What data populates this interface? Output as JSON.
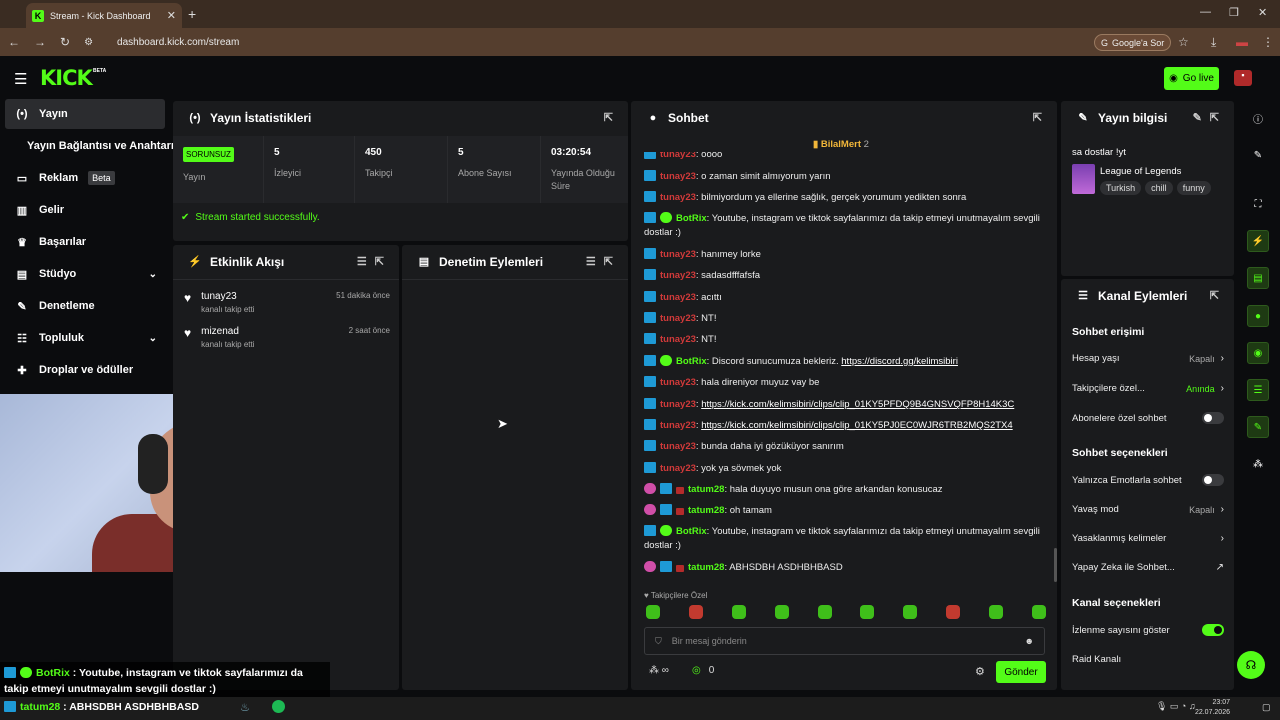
{
  "browser": {
    "tab_title": "Stream - Kick Dashboard",
    "url": "dashboard.kick.com/stream",
    "google_ask": "Google'a Sor"
  },
  "header": {
    "logo": "KICK",
    "beta": "BETA",
    "go_live": "Go live"
  },
  "sidebar": {
    "items": [
      {
        "label": "Yayın",
        "icon": "broadcast-icon"
      },
      {
        "label": "Yayın Bağlantısı ve Anahtarı"
      },
      {
        "label": "Reklam",
        "badge": "Beta",
        "icon": "ad-icon"
      },
      {
        "label": "Gelir",
        "icon": "chart-icon"
      },
      {
        "label": "Başarılar",
        "icon": "trophy-icon"
      },
      {
        "label": "Stüdyo",
        "icon": "studio-icon"
      },
      {
        "label": "Denetleme",
        "icon": "wrench-icon"
      },
      {
        "label": "Topluluk",
        "icon": "community-icon"
      },
      {
        "label": "Droplar ve ödüller",
        "icon": "gift-icon"
      }
    ]
  },
  "stats": {
    "title": "Yayın İstatistikleri",
    "status_badge": "SORUNSUZ",
    "status_label": "Yayın",
    "viewers": {
      "value": "5",
      "label": "İzleyici"
    },
    "followers": {
      "value": "450",
      "label": "Takipçi"
    },
    "subs": {
      "value": "5",
      "label": "Abone Sayısı"
    },
    "uptime": {
      "value": "03:20:54",
      "label": "Yayında Olduğu Süre"
    },
    "success": "Stream started successfully."
  },
  "activity": {
    "title": "Etkinlik Akışı",
    "events": [
      {
        "name": "tunay23",
        "sub": "kanalı takip etti",
        "time": "51 dakika önce"
      },
      {
        "name": "mizenad",
        "sub": "kanalı takip etti",
        "time": "2 saat önce"
      }
    ]
  },
  "moderation": {
    "title": "Denetim Eylemleri"
  },
  "chat": {
    "title": "Sohbet",
    "pinned_user": "BilalMert",
    "pinned_count": "2",
    "messages": [
      {
        "user": "tunay23",
        "text": ": oooo",
        "color": "#d13a3a"
      },
      {
        "user": "tunay23",
        "text": ": o zaman simit almıyorum yarın",
        "color": "#d13a3a"
      },
      {
        "user": "tunay23",
        "text": ": bilmiyordum ya ellerine sağlık, gerçek yorumum yedikten sonra",
        "color": "#d13a3a"
      },
      {
        "user": "BotRix",
        "text": ": Youtube, instagram ve tiktok sayfalarımızı da takip etmeyi unutmayalım sevgili dostlar :)",
        "color": "#53fc18",
        "bot": true
      },
      {
        "user": "tunay23",
        "text": ": hanımey lorke",
        "color": "#d13a3a"
      },
      {
        "user": "tunay23",
        "text": ": sadasdfffafsfa",
        "color": "#d13a3a"
      },
      {
        "user": "tunay23",
        "text": ": acıttı",
        "color": "#d13a3a"
      },
      {
        "user": "tunay23",
        "text": ": NT!",
        "color": "#d13a3a"
      },
      {
        "user": "tunay23",
        "text": ": NT!",
        "color": "#d13a3a"
      },
      {
        "user": "BotRix",
        "text": ": Discord sunucumuza bekleriz. ",
        "link": "https://discord.gg/kelimsibiri",
        "color": "#53fc18",
        "bot": true
      },
      {
        "user": "tunay23",
        "text": ": hala direniyor muyuz vay be",
        "color": "#d13a3a"
      },
      {
        "user": "tunay23",
        "text": ": ",
        "link": "https://kick.com/kelimsibiri/clips/clip_01KY5PFDQ9B4GNSVQFP8H14K3C",
        "color": "#d13a3a"
      },
      {
        "user": "tunay23",
        "text": ": ",
        "link": "https://kick.com/kelimsibiri/clips/clip_01KY5PJ0EC0WJR6TRB2MQS2TX4",
        "color": "#d13a3a"
      },
      {
        "user": "tunay23",
        "text": ": bunda daha iyi gözüküyor sanırım",
        "color": "#d13a3a"
      },
      {
        "user": "tunay23",
        "text": ": yok ya sövmek yok",
        "color": "#d13a3a"
      },
      {
        "user": "tatum28",
        "text": ": hala duyuyo musun ona göre arkandan konusucaz",
        "color": "#53fc18",
        "sub": true
      },
      {
        "user": "tatum28",
        "text": ": oh tamam",
        "color": "#53fc18",
        "sub": true
      },
      {
        "user": "BotRix",
        "text": ": Youtube, instagram ve tiktok sayfalarımızı da takip etmeyi unutmayalım sevgili dostlar :)",
        "color": "#53fc18",
        "bot": true
      },
      {
        "user": "tatum28",
        "text": ": ABHSDBH ASDHBHBASD",
        "color": "#53fc18",
        "sub": true
      }
    ],
    "follower_only": "Takipçilere Özel",
    "placeholder": "Bir mesaj gönderin",
    "count": "0",
    "send": "Gönder"
  },
  "streaminfo": {
    "title": "Yayın bilgisi",
    "stream_title": "sa dostlar !yt",
    "category": "League of Legends",
    "tags": [
      "Turkish",
      "chill",
      "funny"
    ]
  },
  "channel": {
    "title": "Kanal Eylemleri",
    "chat_access": "Sohbet erişimi",
    "account_age": {
      "label": "Hesap yaşı",
      "value": "Kapalı"
    },
    "followers_only": {
      "label": "Takipçilere özel...",
      "value": "Anında"
    },
    "subs_only": "Abonelere özel sohbet",
    "chat_options": "Sohbet seçenekleri",
    "emote_only": "Yalnızca Emotlarla sohbet",
    "slow_mode": {
      "label": "Yavaş mod",
      "value": "Kapalı"
    },
    "banned_words": "Yasaklanmış kelimeler",
    "ai_chat": "Yapay Zeka ile Sohbet...",
    "channel_options": "Kanal seçenekleri",
    "show_views": "İzlenme sayısını göster",
    "raid": "Raid Kanalı"
  },
  "overlay": {
    "bot_user": "BotRix",
    "bot_text": " : Youtube, instagram ve tiktok sayfalarımızı da takip etmeyi unutmayalım sevgili dostlar :)",
    "user": "tatum28",
    "text": " : ABHSDBH ASDHBHBASD"
  },
  "taskbar": {
    "time": "23:07",
    "date": "22.07.2026"
  },
  "colors": {
    "accent": "#53fc18",
    "panel": "#1a1b1d",
    "bg": "#0b0c0e"
  }
}
